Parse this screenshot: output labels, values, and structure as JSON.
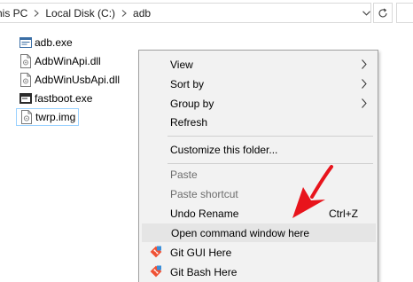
{
  "address_bar": {
    "crumbs": [
      "his PC",
      "Local Disk (C:)",
      "adb"
    ],
    "dropdown_icon": "chevron-down-icon",
    "refresh_icon": "refresh-icon"
  },
  "files": [
    {
      "name": "adb.exe",
      "icon": "exe-icon"
    },
    {
      "name": "AdbWinApi.dll",
      "icon": "dll-icon"
    },
    {
      "name": "AdbWinUsbApi.dll",
      "icon": "dll-icon"
    },
    {
      "name": "fastboot.exe",
      "icon": "exe-icon"
    },
    {
      "name": "twrp.img",
      "icon": "img-file-icon",
      "selected": true
    }
  ],
  "context_menu": {
    "view": "View",
    "sort_by": "Sort by",
    "group_by": "Group by",
    "refresh": "Refresh",
    "customize": "Customize this folder...",
    "paste": "Paste",
    "paste_shortcut": "Paste shortcut",
    "undo_rename": "Undo Rename",
    "undo_shortcut": "Ctrl+Z",
    "open_cmd": "Open command window here",
    "git_gui": "Git GUI Here",
    "git_bash": "Git Bash Here"
  },
  "colors": {
    "menu_bg": "#f2f2f2",
    "menu_hover": "#e5e5e5",
    "disabled_text": "#6d6d6d",
    "annotation_arrow": "#e8141c",
    "selection_border": "#99d1ff"
  }
}
